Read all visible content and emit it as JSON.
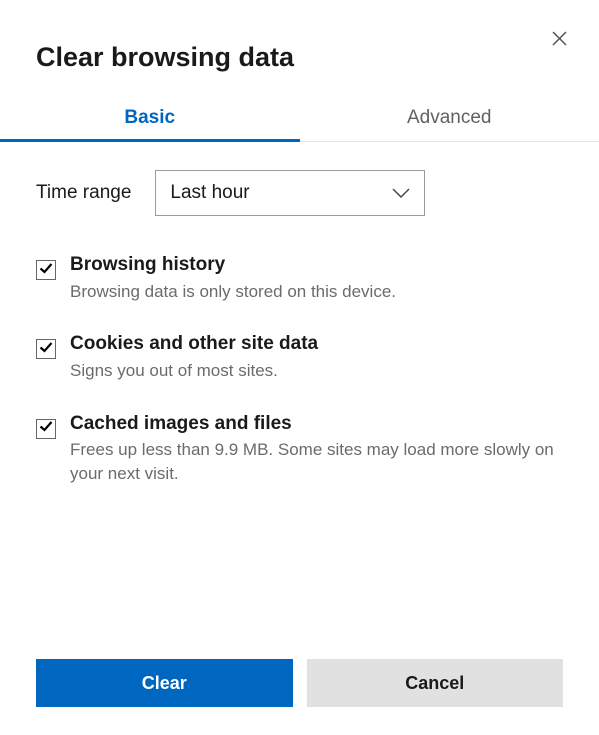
{
  "dialog": {
    "title": "Clear browsing data"
  },
  "tabs": {
    "basic": "Basic",
    "advanced": "Advanced"
  },
  "timeRange": {
    "label": "Time range",
    "selected": "Last hour"
  },
  "options": [
    {
      "title": "Browsing history",
      "desc": "Browsing data is only stored on this device.",
      "checked": true
    },
    {
      "title": "Cookies and other site data",
      "desc": "Signs you out of most sites.",
      "checked": true
    },
    {
      "title": "Cached images and files",
      "desc": "Frees up less than 9.9 MB. Some sites may load more slowly on your next visit.",
      "checked": true
    }
  ],
  "buttons": {
    "clear": "Clear",
    "cancel": "Cancel"
  }
}
